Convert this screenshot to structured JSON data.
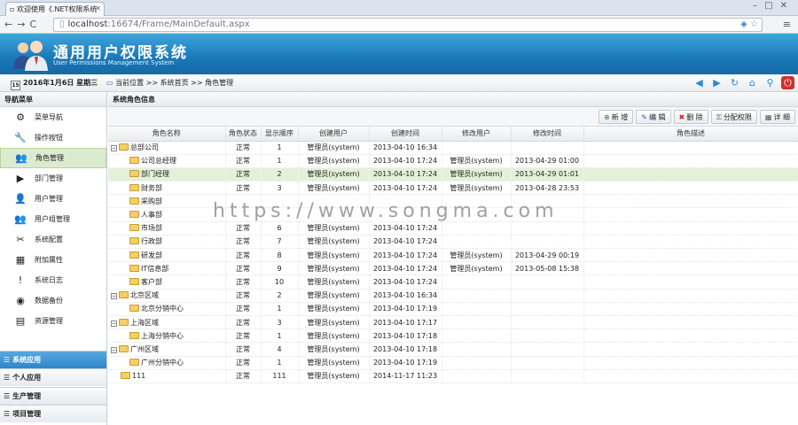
{
  "browser": {
    "tab_title": "欢迎使用《.NET权限系统",
    "url_host": "localhost",
    "url_rest": ":16674/Frame/MainDefault.aspx"
  },
  "banner": {
    "title": "通用用户权限系统",
    "subtitle": "User Permissions Management System"
  },
  "infobar": {
    "date": "2016年1月6日 星期三",
    "location": "当前位置  >> 系统首页  >> 角色管理",
    "calendar_day": "15"
  },
  "sidebar": {
    "header": "导航菜单",
    "items": [
      {
        "label": "菜单导航",
        "icon": "sitemap-icon",
        "glyph": "⚙"
      },
      {
        "label": "操作按钮",
        "icon": "tools-icon",
        "glyph": "🔧"
      },
      {
        "label": "角色管理",
        "icon": "role-icon",
        "glyph": "👥"
      },
      {
        "label": "部门管理",
        "icon": "department-icon",
        "glyph": "▶"
      },
      {
        "label": "用户管理",
        "icon": "user-icon",
        "glyph": "👤"
      },
      {
        "label": "用户组管理",
        "icon": "user-group-icon",
        "glyph": "👥"
      },
      {
        "label": "系统配置",
        "icon": "config-icon",
        "glyph": "✂"
      },
      {
        "label": "附加属性",
        "icon": "attribute-icon",
        "glyph": "▦"
      },
      {
        "label": "系统日志",
        "icon": "log-icon",
        "glyph": "!"
      },
      {
        "label": "数据备份",
        "icon": "backup-icon",
        "glyph": "◉"
      },
      {
        "label": "资源管理",
        "icon": "resource-icon",
        "glyph": "▤"
      }
    ],
    "groups": [
      {
        "label": "系统应用"
      },
      {
        "label": "个人应用"
      },
      {
        "label": "生产管理"
      },
      {
        "label": "项目管理"
      }
    ]
  },
  "main": {
    "header": "系统角色信息",
    "buttons": [
      {
        "label": "新 增",
        "glyph": "⊕",
        "color": "#2e8b2e"
      },
      {
        "label": "编 辑",
        "glyph": "✎",
        "color": "#2a5db0"
      },
      {
        "label": "删 除",
        "glyph": "✖",
        "color": "#d02020"
      },
      {
        "label": "分配权限",
        "glyph": "⚿",
        "color": "#555555"
      },
      {
        "label": "详 细",
        "glyph": "▦",
        "color": "#555555"
      }
    ],
    "columns": [
      "角色名称",
      "角色状态",
      "显示顺序",
      "创建用户",
      "创建时间",
      "修改用户",
      "修改时间",
      "角色描述"
    ],
    "rows": [
      {
        "name": "总部公司",
        "level": 0,
        "expander": "⊟",
        "status": "正常",
        "order": "1",
        "creator": "管理员(system)",
        "created": "2013-04-10 16:34",
        "modifier": "",
        "modified": "",
        "desc": ""
      },
      {
        "name": "公司总经理",
        "level": 1,
        "expander": "",
        "status": "正常",
        "order": "1",
        "creator": "管理员(system)",
        "created": "2013-04-10 17:24",
        "modifier": "管理员(system)",
        "modified": "2013-04-29 01:00",
        "desc": ""
      },
      {
        "name": "部门经理",
        "level": 1,
        "expander": "",
        "status": "正常",
        "order": "2",
        "creator": "管理员(system)",
        "created": "2013-04-10 17:24",
        "modifier": "管理员(system)",
        "modified": "2013-04-29 01:01",
        "desc": "",
        "selected": true
      },
      {
        "name": "财务部",
        "level": 1,
        "expander": "",
        "status": "正常",
        "order": "3",
        "creator": "管理员(system)",
        "created": "2013-04-10 17:24",
        "modifier": "管理员(system)",
        "modified": "2013-04-28 23:53",
        "desc": ""
      },
      {
        "name": "采购部",
        "level": 1,
        "expander": "",
        "status": "",
        "order": "",
        "creator": "",
        "created": "",
        "modifier": "",
        "modified": "",
        "desc": ""
      },
      {
        "name": "人事部",
        "level": 1,
        "expander": "",
        "status": "",
        "order": "",
        "creator": "",
        "created": "",
        "modifier": "",
        "modified": "",
        "desc": ""
      },
      {
        "name": "市场部",
        "level": 1,
        "expander": "",
        "status": "正常",
        "order": "6",
        "creator": "管理员(system)",
        "created": "2013-04-10 17:24",
        "modifier": "",
        "modified": "",
        "desc": ""
      },
      {
        "name": "行政部",
        "level": 1,
        "expander": "",
        "status": "正常",
        "order": "7",
        "creator": "管理员(system)",
        "created": "2013-04-10 17:24",
        "modifier": "",
        "modified": "",
        "desc": ""
      },
      {
        "name": "研发部",
        "level": 1,
        "expander": "",
        "status": "正常",
        "order": "8",
        "creator": "管理员(system)",
        "created": "2013-04-10 17:24",
        "modifier": "管理员(system)",
        "modified": "2013-04-29 00:19",
        "desc": ""
      },
      {
        "name": "IT信息部",
        "level": 1,
        "expander": "",
        "status": "正常",
        "order": "9",
        "creator": "管理员(system)",
        "created": "2013-04-10 17:24",
        "modifier": "管理员(system)",
        "modified": "2013-05-08 15:38",
        "desc": ""
      },
      {
        "name": "客户部",
        "level": 1,
        "expander": "",
        "status": "正常",
        "order": "10",
        "creator": "管理员(system)",
        "created": "2013-04-10 17:24",
        "modifier": "",
        "modified": "",
        "desc": ""
      },
      {
        "name": "北京区域",
        "level": 0,
        "expander": "⊟",
        "status": "正常",
        "order": "2",
        "creator": "管理员(system)",
        "created": "2013-04-10 16:34",
        "modifier": "",
        "modified": "",
        "desc": ""
      },
      {
        "name": "北京分销中心",
        "level": 1,
        "expander": "",
        "status": "正常",
        "order": "1",
        "creator": "管理员(system)",
        "created": "2013-04-10 17:19",
        "modifier": "",
        "modified": "",
        "desc": ""
      },
      {
        "name": "上海区域",
        "level": 0,
        "expander": "⊟",
        "status": "正常",
        "order": "3",
        "creator": "管理员(system)",
        "created": "2013-04-10 17:17",
        "modifier": "",
        "modified": "",
        "desc": ""
      },
      {
        "name": "上海分销中心",
        "level": 1,
        "expander": "",
        "status": "正常",
        "order": "1",
        "creator": "管理员(system)",
        "created": "2013-04-10 17:18",
        "modifier": "",
        "modified": "",
        "desc": ""
      },
      {
        "name": "广州区域",
        "level": 0,
        "expander": "⊟",
        "status": "正常",
        "order": "4",
        "creator": "管理员(system)",
        "created": "2013-04-10 17:18",
        "modifier": "",
        "modified": "",
        "desc": ""
      },
      {
        "name": "广州分销中心",
        "level": 1,
        "expander": "",
        "status": "正常",
        "order": "1",
        "creator": "管理员(system)",
        "created": "2013-04-10 17:19",
        "modifier": "",
        "modified": "",
        "desc": ""
      },
      {
        "name": "111",
        "level": 0,
        "expander": "",
        "status": "正常",
        "order": "111",
        "creator": "管理员(system)",
        "created": "2014-11-17 11:23",
        "modifier": "",
        "modified": "",
        "desc": ""
      }
    ]
  },
  "watermark": "https://www.songma.com"
}
